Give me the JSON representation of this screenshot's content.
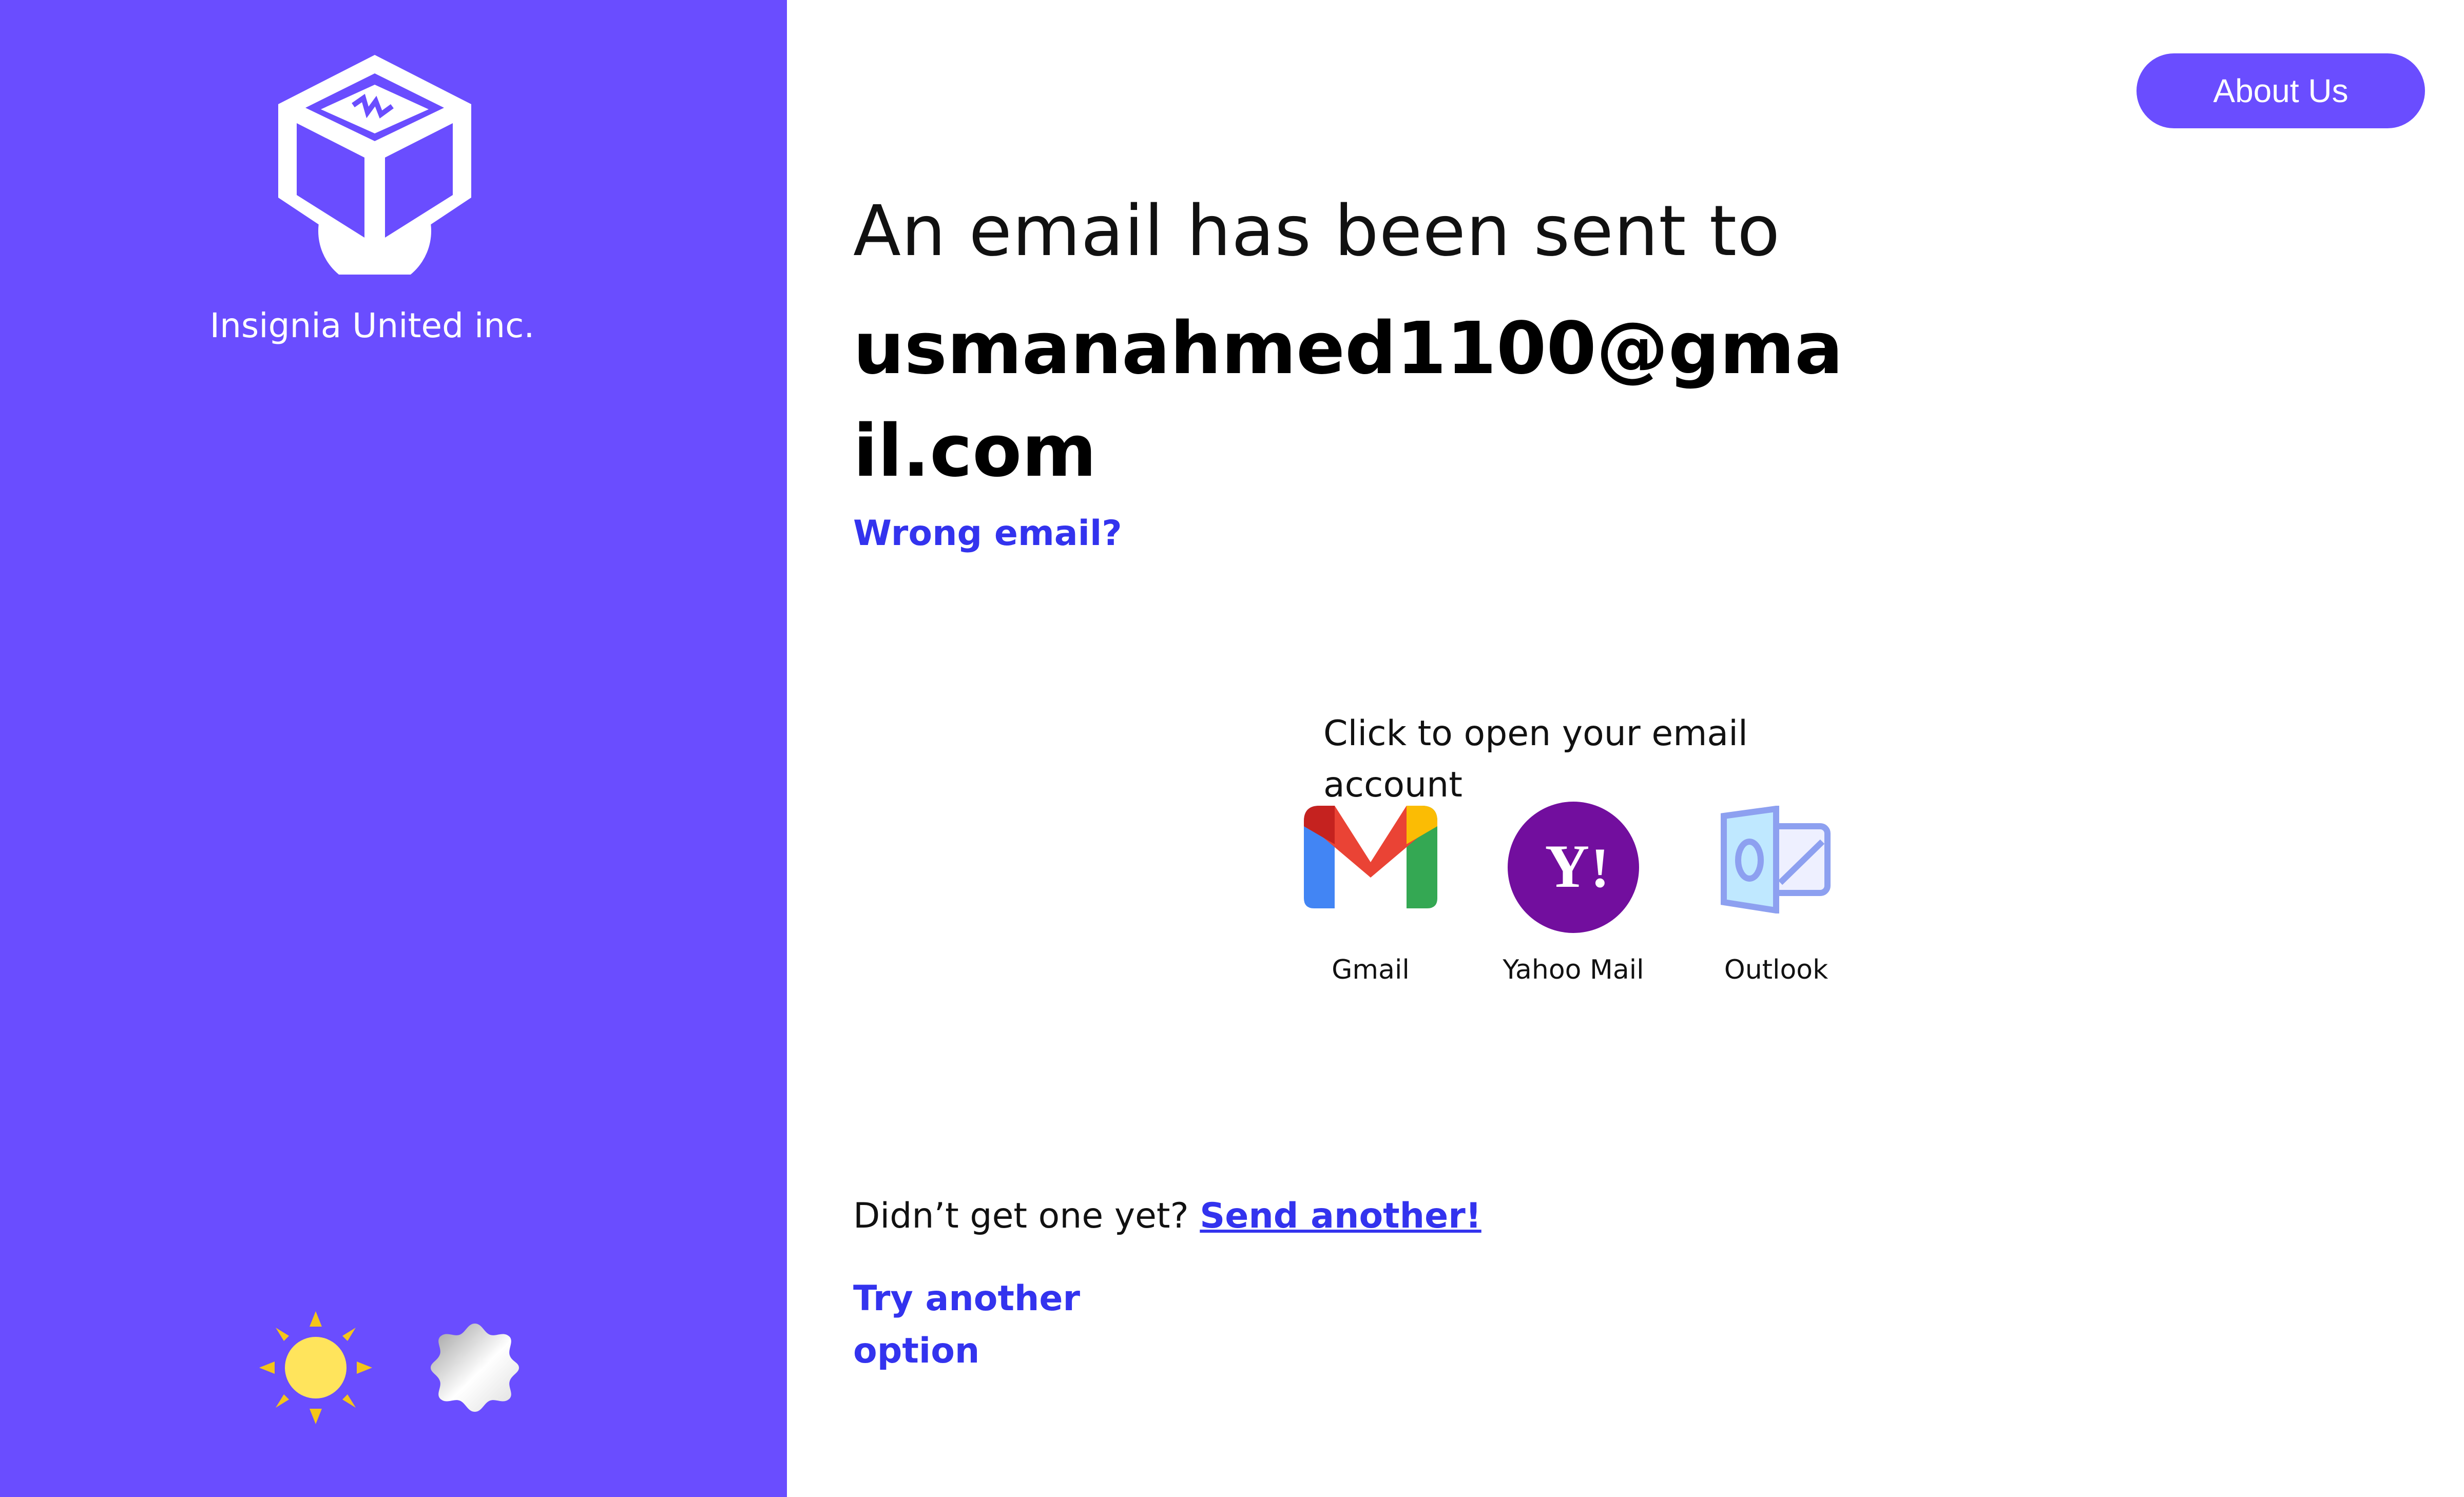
{
  "sidebar": {
    "company_name": "Insignia United inc.",
    "logo_icon": "cube-box-logo",
    "theme_icon": "sun-icon",
    "settings_icon": "gear-icon"
  },
  "header": {
    "about_label": "About Us"
  },
  "main": {
    "headline": "An email has been sent to",
    "email": "usmanahmed1100@gmail.com",
    "wrong_email_label": "Wrong email?",
    "open_prompt": "Click to open your email account",
    "mail_options": [
      {
        "label": "Gmail",
        "icon": "gmail-icon"
      },
      {
        "label": "Yahoo Mail",
        "icon": "yahoo-mail-icon"
      },
      {
        "label": "Outlook",
        "icon": "outlook-icon"
      }
    ],
    "resend_prompt": "Didn’t get one yet?",
    "resend_label": "Send another!",
    "try_another_label": "Try another option"
  },
  "colors": {
    "brand": "#6a4dff",
    "link": "#3333ee",
    "sun": "#ffe45c",
    "sun_rays": "#f5c518"
  }
}
